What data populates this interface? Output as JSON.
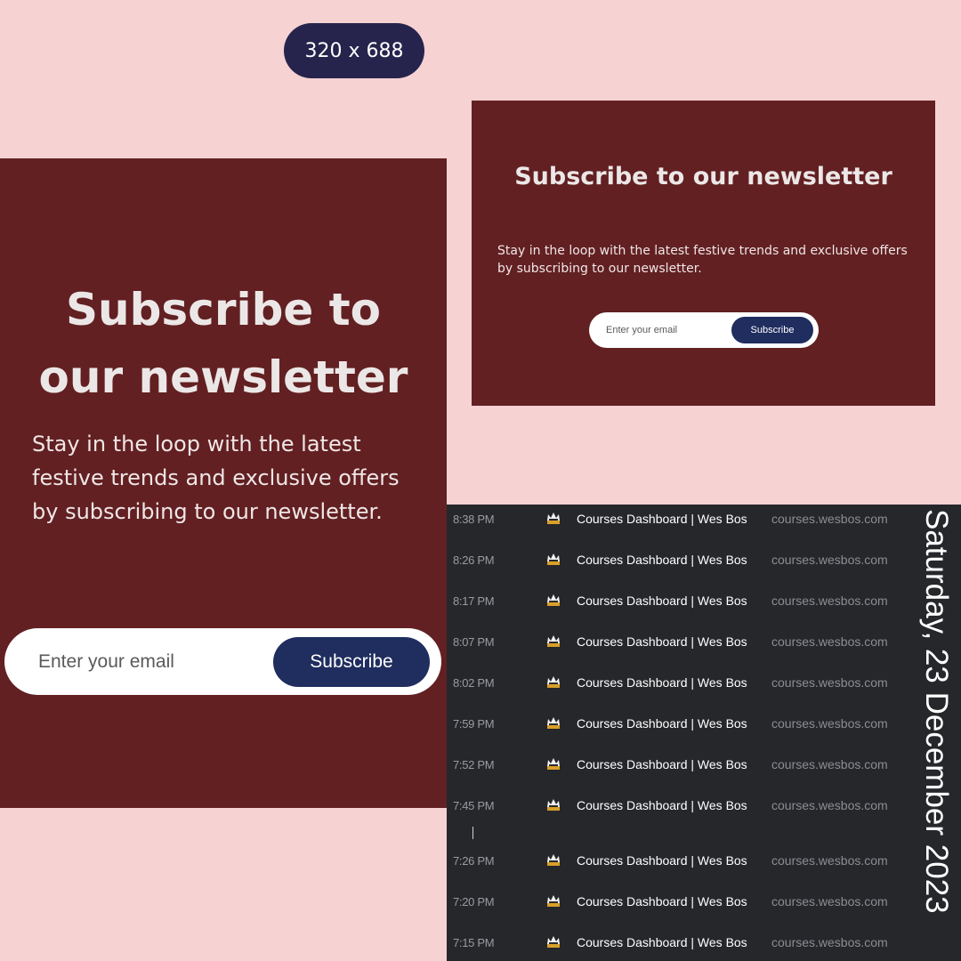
{
  "badge": {
    "label": "320 x 688"
  },
  "newsletter_large": {
    "title": "Subscribe to our newsletter",
    "text": "Stay in the loop with the latest festive trends and exclusive offers by subscribing to our newsletter.",
    "email_placeholder": "Enter your email",
    "button_label": "Subscribe"
  },
  "newsletter_small": {
    "title": "Subscribe to our newsletter",
    "text": "Stay in the loop with the latest festive trends and exclusive offers by subscribing to our newsletter.",
    "email_placeholder": "Enter your email",
    "button_label": "Subscribe"
  },
  "history": {
    "date": "Saturday, 23 December 2023",
    "favicon": "crown-icon",
    "rows": [
      {
        "time": "8:38 PM",
        "title": "Courses Dashboard | Wes Bos",
        "domain": "courses.wesbos.com"
      },
      {
        "time": "8:26 PM",
        "title": "Courses Dashboard | Wes Bos",
        "domain": "courses.wesbos.com"
      },
      {
        "time": "8:17 PM",
        "title": "Courses Dashboard | Wes Bos",
        "domain": "courses.wesbos.com"
      },
      {
        "time": "8:07 PM",
        "title": "Courses Dashboard | Wes Bos",
        "domain": "courses.wesbos.com"
      },
      {
        "time": "8:02 PM",
        "title": "Courses Dashboard | Wes Bos",
        "domain": "courses.wesbos.com"
      },
      {
        "time": "7:59 PM",
        "title": "Courses Dashboard | Wes Bos",
        "domain": "courses.wesbos.com"
      },
      {
        "time": "7:52 PM",
        "title": "Courses Dashboard | Wes Bos",
        "domain": "courses.wesbos.com"
      },
      {
        "time": "7:45 PM",
        "title": "Courses Dashboard | Wes Bos",
        "domain": "courses.wesbos.com"
      },
      {
        "time": "7:26 PM",
        "title": "Courses Dashboard | Wes Bos",
        "domain": "courses.wesbos.com"
      },
      {
        "time": "7:20 PM",
        "title": "Courses Dashboard | Wes Bos",
        "domain": "courses.wesbos.com"
      },
      {
        "time": "7:15 PM",
        "title": "Courses Dashboard | Wes Bos",
        "domain": "courses.wesbos.com"
      }
    ]
  },
  "colors": {
    "page_bg": "#f6d2d3",
    "card_bg": "#622022",
    "button_bg": "#1f2d5f",
    "badge_bg": "#26244d",
    "history_bg": "#26272b"
  }
}
